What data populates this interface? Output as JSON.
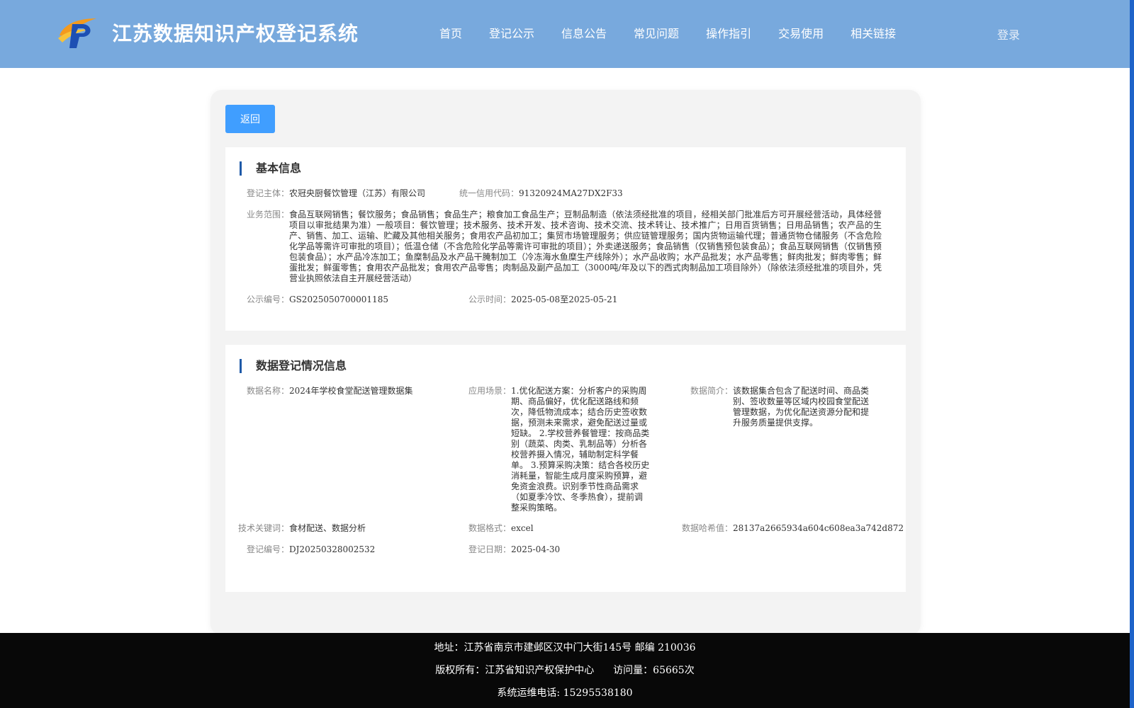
{
  "header": {
    "title": "江苏数据知识产权登记系统",
    "nav": [
      "首页",
      "登记公示",
      "信息公告",
      "常见问题",
      "操作指引",
      "交易使用",
      "相关链接"
    ],
    "login": "登录"
  },
  "toolbar": {
    "back_label": "返回"
  },
  "basic_info": {
    "title": "基本信息",
    "subject_label": "登记主体：",
    "subject": "农冠央厨餐饮管理（江苏）有限公司",
    "credit_code_label": "统一信用代码：",
    "credit_code": "91320924MA27DX2F33",
    "scope_label": "业务范围：",
    "scope": "食品互联网销售；餐饮服务；食品销售；食品生产；粮食加工食品生产；豆制品制造（依法须经批准的项目，经相关部门批准后方可开展经营活动，具体经营项目以审批结果为准）一般项目：餐饮管理；技术服务、技术开发、技术咨询、技术交流、技术转让、技术推广；日用百货销售；日用品销售；农产品的生产、销售、加工、运输、贮藏及其他相关服务；食用农产品初加工；集贸市场管理服务；供应链管理服务；国内货物运输代理；普通货物仓储服务（不含危险化学品等需许可审批的项目）；低温仓储（不含危险化学品等需许可审批的项目）；外卖递送服务；食品销售（仅销售预包装食品）；食品互联网销售（仅销售预包装食品）；水产品冷冻加工；鱼糜制品及水产品干腌制加工（冷冻海水鱼糜生产线除外）；水产品收购；水产品批发；水产品零售；鲜肉批发；鲜肉零售；鲜蛋批发；鲜蛋零售；食用农产品批发；食用农产品零售；肉制品及副产品加工（3000吨/年及以下的西式肉制品加工项目除外）（除依法须经批准的项目外，凭营业执照依法自主开展经营活动）",
    "notice_no_label": "公示编号：",
    "notice_no": "GS2025050700001185",
    "notice_time_label": "公示时间：",
    "notice_time": "2025-05-08至2025-05-21"
  },
  "data_info": {
    "title": "数据登记情况信息",
    "name_label": "数据名称：",
    "name": "2024年学校食堂配送管理数据集",
    "scenario_label": "应用场景：",
    "scenario": "1.优化配送方案：分析客户的采购周期、商品偏好，优化配送路线和频次，降低物流成本；结合历史签收数据，预测未来需求，避免配送过量或短缺。 2.学校营养餐管理：按商品类别（蔬菜、肉类、乳制品等）分析各校营养摄入情况，辅助制定科学餐单。 3.预算采购决策：结合各校历史消耗量，智能生成月度采购预算，避免资金浪费。识别季节性商品需求（如夏季冷饮、冬季热食），提前调整采购策略。",
    "intro_label": "数据简介：",
    "intro": "该数据集合包含了配送时间、商品类别、签收数量等区域内校园食堂配送管理数据，为优化配送资源分配和提升服务质量提供支撑。",
    "keywords_label": "技术关键词：",
    "keywords": "食材配送、数据分析",
    "format_label": "数据格式：",
    "format": "excel",
    "hash_label": "数据哈希值：",
    "hash": "28137a2665934a604c608ea3a742d872",
    "reg_no_label": "登记编号：",
    "reg_no": "DJ20250328002532",
    "reg_date_label": "登记日期：",
    "reg_date": "2025-04-30"
  },
  "footer": {
    "address": "地址：江苏省南京市建邺区汉中门大街145号 邮编 210036",
    "copyright": "版权所有：江苏省知识产权保护中心",
    "visits": "访问量：65665次",
    "phone": "系统运维电话: 15295538180"
  },
  "colors": {
    "header_bg": "#78a9dd",
    "primary_button": "#409eff",
    "section_accent": "#1f5aa8",
    "footer_bg": "#080808"
  }
}
